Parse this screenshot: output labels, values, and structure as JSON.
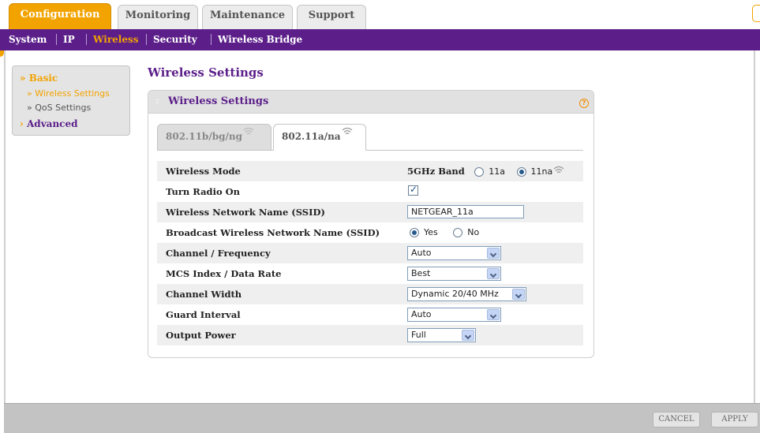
{
  "top_tabs": [
    {
      "label": "Configuration",
      "active": true
    },
    {
      "label": "Monitoring",
      "active": false
    },
    {
      "label": "Maintenance",
      "active": false
    },
    {
      "label": "Support",
      "active": false
    }
  ],
  "sub_nav": {
    "items": [
      {
        "label": "System"
      },
      {
        "label": "IP"
      },
      {
        "label": "Wireless",
        "active": true
      },
      {
        "label": "Security"
      },
      {
        "label": "Wireless Bridge"
      }
    ]
  },
  "sidebar": {
    "basic": "Basic",
    "basic_marker": "»",
    "items": [
      {
        "label": "» Wireless Settings",
        "active": true
      },
      {
        "label": "» QoS Settings",
        "active": false
      }
    ],
    "advanced": "Advanced",
    "advanced_marker": "›"
  },
  "page_title": "Wireless Settings",
  "panel": {
    "title": "Wireless Settings",
    "help_icon": "?"
  },
  "band_tabs": [
    {
      "label": "802.11b/bg/ng",
      "active": false,
      "icon": "wifi-icon"
    },
    {
      "label": "802.11a/na",
      "active": true,
      "icon": "wifi-icon"
    }
  ],
  "settings": {
    "wireless_mode": {
      "label": "Wireless Mode",
      "band_label": "5GHz Band",
      "options": [
        {
          "label": "11a",
          "selected": false
        },
        {
          "label": "11na",
          "selected": true
        }
      ]
    },
    "radio_on": {
      "label": "Turn Radio On",
      "checked": true,
      "tick": "✓"
    },
    "ssid": {
      "label": "Wireless Network Name (SSID)",
      "value": "NETGEAR_11a"
    },
    "broadcast": {
      "label": "Broadcast Wireless Network Name (SSID)",
      "options": [
        {
          "label": "Yes",
          "selected": true
        },
        {
          "label": "No",
          "selected": false
        }
      ]
    },
    "channel": {
      "label": "Channel / Frequency",
      "value": "Auto"
    },
    "mcs": {
      "label": "MCS Index / Data Rate",
      "value": "Best"
    },
    "channel_width": {
      "label": "Channel Width",
      "value": "Dynamic 20/40 MHz"
    },
    "guard_interval": {
      "label": "Guard Interval",
      "value": "Auto"
    },
    "output_power": {
      "label": "Output Power",
      "value": "Full"
    }
  },
  "footer": {
    "cancel": "CANCEL",
    "apply": "APPLY"
  },
  "colors": {
    "accent": "#f2a300",
    "brand_purple": "#5c1f8a"
  }
}
